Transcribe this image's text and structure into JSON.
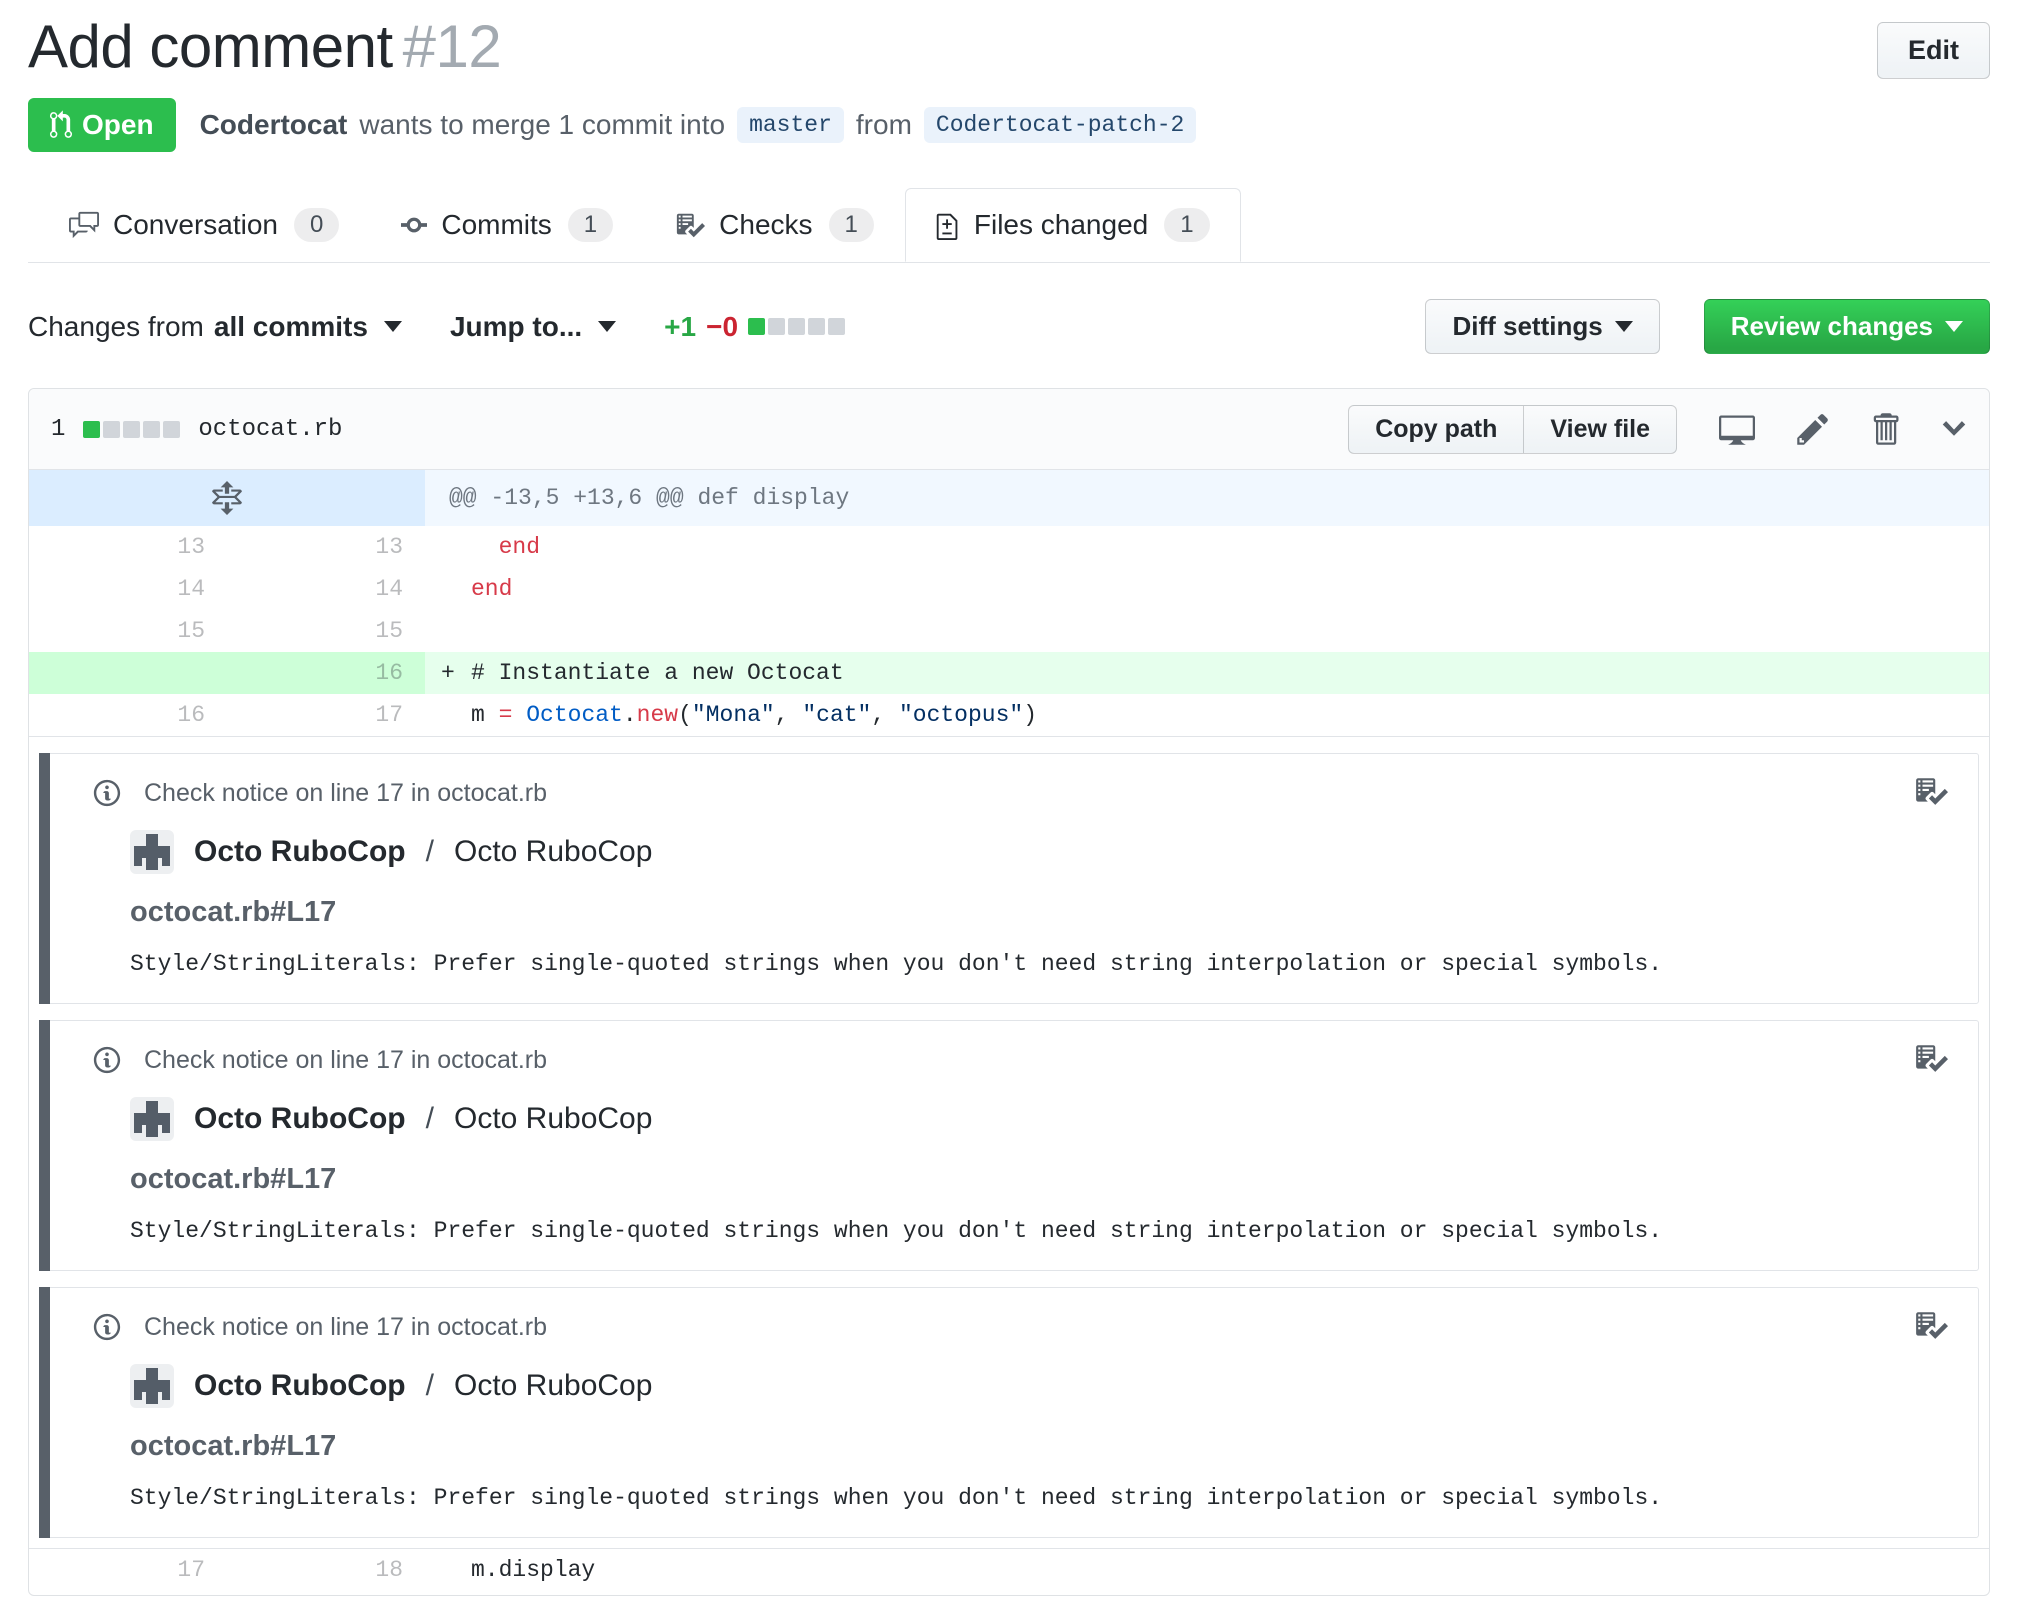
{
  "header": {
    "title": "Add comment",
    "number": "#12",
    "edit_button": "Edit",
    "state_badge": "Open",
    "author": "Codertocat",
    "meta_middle": "wants to merge 1 commit into",
    "base_branch": "master",
    "meta_from": "from",
    "head_branch": "Codertocat-patch-2"
  },
  "tabs": [
    {
      "label": "Conversation",
      "count": "0",
      "icon": "comment-discussion-icon",
      "active": false
    },
    {
      "label": "Commits",
      "count": "1",
      "icon": "git-commit-icon",
      "active": false
    },
    {
      "label": "Checks",
      "count": "1",
      "icon": "checklist-icon",
      "active": false
    },
    {
      "label": "Files changed",
      "count": "1",
      "icon": "file-diff-icon",
      "active": true
    }
  ],
  "toolbar": {
    "changes_from_label": "Changes from",
    "changes_from_value": "all commits",
    "jump_to": "Jump to...",
    "additions": "+1",
    "deletions": "−0",
    "diffstat": {
      "green_blocks": 1,
      "gray_blocks": 4
    },
    "diff_settings": "Diff settings",
    "review_changes": "Review changes"
  },
  "file": {
    "changed_lines": "1",
    "diffstat": {
      "green_blocks": 1,
      "gray_blocks": 4
    },
    "name": "octocat.rb",
    "copy_path": "Copy path",
    "view_file": "View file",
    "hunk": "@@ -13,5 +13,6 @@ def display"
  },
  "diff_rows_top": [
    {
      "old": "13",
      "new": "13",
      "sign": " ",
      "type": "context",
      "tokens": [
        {
          "t": "  ",
          "c": "plain"
        },
        {
          "t": "end",
          "c": "keyword"
        }
      ]
    },
    {
      "old": "14",
      "new": "14",
      "sign": " ",
      "type": "context",
      "tokens": [
        {
          "t": "end",
          "c": "keyword"
        }
      ]
    },
    {
      "old": "15",
      "new": "15",
      "sign": " ",
      "type": "context",
      "tokens": []
    },
    {
      "old": "",
      "new": "16",
      "sign": "+",
      "type": "add",
      "tokens": [
        {
          "t": "# Instantiate a new Octocat",
          "c": "plain"
        }
      ]
    },
    {
      "old": "16",
      "new": "17",
      "sign": " ",
      "type": "context",
      "tokens": [
        {
          "t": "m ",
          "c": "plain"
        },
        {
          "t": "=",
          "c": "keyword"
        },
        {
          "t": " ",
          "c": "plain"
        },
        {
          "t": "Octocat",
          "c": "constant"
        },
        {
          "t": ".",
          "c": "plain"
        },
        {
          "t": "new",
          "c": "keyword"
        },
        {
          "t": "(",
          "c": "plain"
        },
        {
          "t": "\"Mona\"",
          "c": "string"
        },
        {
          "t": ", ",
          "c": "plain"
        },
        {
          "t": "\"cat\"",
          "c": "string"
        },
        {
          "t": ", ",
          "c": "plain"
        },
        {
          "t": "\"octopus\"",
          "c": "string"
        },
        {
          "t": ")",
          "c": "plain"
        }
      ]
    }
  ],
  "diff_rows_tail": [
    {
      "old": "17",
      "new": "18",
      "sign": " ",
      "type": "context",
      "tokens": [
        {
          "t": "m.display",
          "c": "plain"
        }
      ]
    }
  ],
  "annotations": [
    {
      "header": "Check notice on line 17 in octocat.rb",
      "tool": "Octo RuboCop",
      "separator": "/",
      "check_name": "Octo RuboCop",
      "path": "octocat.rb#L17",
      "message": "Style/StringLiterals: Prefer single-quoted strings when you don't need string interpolation or special symbols."
    },
    {
      "header": "Check notice on line 17 in octocat.rb",
      "tool": "Octo RuboCop",
      "separator": "/",
      "check_name": "Octo RuboCop",
      "path": "octocat.rb#L17",
      "message": "Style/StringLiterals: Prefer single-quoted strings when you don't need string interpolation or special symbols."
    },
    {
      "header": "Check notice on line 17 in octocat.rb",
      "tool": "Octo RuboCop",
      "separator": "/",
      "check_name": "Octo RuboCop",
      "path": "octocat.rb#L17",
      "message": "Style/StringLiterals: Prefer single-quoted strings when you don't need string interpolation or special symbols."
    }
  ],
  "colors": {
    "plain": "#24292e",
    "keyword": "#d73a49",
    "constant": "#005cc5",
    "string": "#032f62",
    "open_badge_green": "#2cbe4e",
    "review_button_green": "#28a745",
    "additions_green": "#28a745",
    "deletions_red": "#cb2431",
    "diffstat_green": "#2cbe4e",
    "diffstat_gray": "#d1d5da",
    "added_line_bg": "#e6ffed",
    "added_gutter_bg": "#cdffd8",
    "hunk_gutter_bg": "#dbedff",
    "hunk_bg": "#f1f8ff",
    "annotation_bar": "#586069",
    "branch_label_bg": "#eaf2fb"
  }
}
